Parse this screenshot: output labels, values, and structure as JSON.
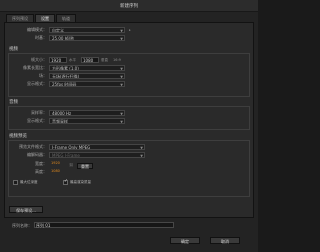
{
  "window": {
    "title": "新建序列"
  },
  "tabs": [
    {
      "label": "序列预设",
      "active": false
    },
    {
      "label": "设置",
      "active": true
    },
    {
      "label": "轨道",
      "active": false
    }
  ],
  "general": {
    "edit_mode_label": "编辑模式：",
    "edit_mode_value": "自定义",
    "timebase_label": "时基：",
    "timebase_value": "25.00 帧/秒"
  },
  "video": {
    "section_label": "视频",
    "frame_size_label": "帧大小：",
    "frame_w": "1920",
    "horiz_label": "水平",
    "frame_h": "1080",
    "vert_label": "垂直",
    "ratio": "16:9",
    "pixel_aspect_label": "像素长宽比：",
    "pixel_aspect_value": "方形像素 (1.0)",
    "fields_label": "场：",
    "fields_value": "无场(逐行扫描)",
    "display_format_label": "显示格式：",
    "display_format_value": "25fps 时间码"
  },
  "audio": {
    "section_label": "音频",
    "sample_rate_label": "采样率：",
    "sample_rate_value": "48000 Hz",
    "display_format_label": "显示格式：",
    "display_format_value": "音频采样"
  },
  "preview": {
    "section_label": "视频预览",
    "file_format_label": "预览文件格式：",
    "file_format_value": "I-Frame Only MPEG",
    "codec_label": "编解码器：",
    "codec_value": "MPEG I-Frame",
    "width_label": "宽度：",
    "width_value": "1920",
    "height_label": "高度：",
    "height_value": "1080",
    "reset_label": "重置",
    "max_bit_depth_label": "最大位深度",
    "max_bit_depth_checked": false,
    "max_render_quality_label": "最高渲染质量",
    "max_render_quality_checked": true
  },
  "buttons": {
    "save_preset": "保存预设...",
    "ok": "确定",
    "cancel": "取消"
  },
  "sequence_name": {
    "label": "序列名称：",
    "value": "序列 01"
  }
}
